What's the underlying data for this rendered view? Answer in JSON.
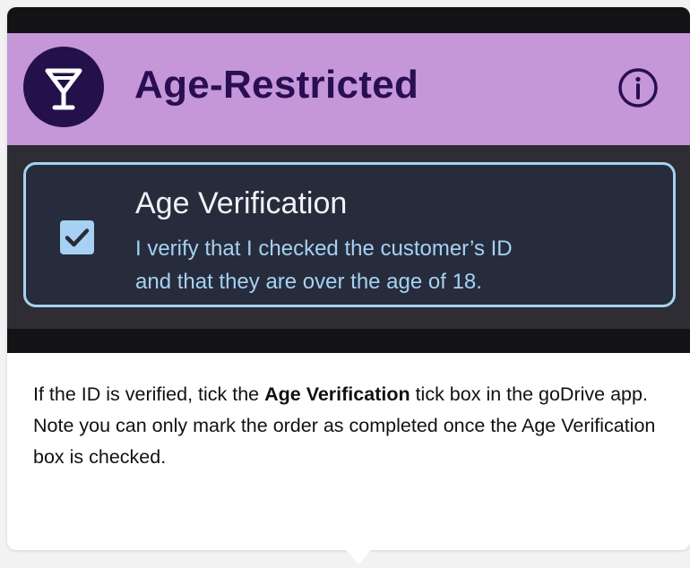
{
  "colors": {
    "header_background": "#c597d8",
    "header_text": "#2a0e54",
    "icon_circle": "#24104a",
    "card_background": "#272c3c",
    "card_border": "#a6d1f2",
    "checkbox_fill": "#a6d1f2",
    "page_background": "#f2f2f3"
  },
  "header": {
    "icon": "cocktail-glass-icon",
    "title": "Age-Restricted",
    "info_icon": "info-icon"
  },
  "verification": {
    "checked": true,
    "title": "Age Verification",
    "line1": "I verify that I checked the customer’s ID",
    "line2": "and that they are over the age of 18."
  },
  "instructions": {
    "p1_before": "If the ID is verified, tick the ",
    "p1_bold": "Age Verification",
    "p1_after": " tick box in the goDrive app.",
    "p2": "Note you can only mark the order as completed once the Age Verification box is checked."
  }
}
